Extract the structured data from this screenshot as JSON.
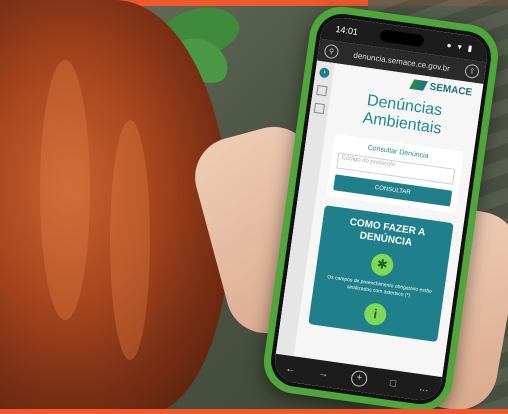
{
  "photo": {
    "description_free": true
  },
  "phone": {
    "status": {
      "time": "14:01",
      "icons": "● ▾ ▮"
    },
    "urlbar": {
      "url": "denuncia.semace.ce.gov.br",
      "left_icon": "search-icon",
      "right_icon": "share-icon"
    },
    "page": {
      "logo_text": "SEMACE",
      "title_line1": "Denúncias",
      "title_line2": "Ambientais",
      "consult": {
        "label": "Consultar Denúncia",
        "placeholder": "Código do protocolo",
        "button": "CONSULTAR"
      },
      "howto": {
        "title_line1": "COMO FAZER A",
        "title_line2": "DENÚNCIA",
        "icon": "asterisk-icon",
        "text": "Os campos de preenchimento obrigatório estão sinalizados com asterisco (*)",
        "info_icon": "info-icon",
        "info_glyph": "i"
      }
    },
    "nav": {
      "back": "←",
      "forward": "→",
      "plus": "+",
      "tabs": "□",
      "more": "…"
    }
  },
  "colors": {
    "accent_bar": "#ee5a2c",
    "phone_case": "#4fa63a",
    "teal": "#1f7f8a",
    "green": "#7ed957"
  }
}
